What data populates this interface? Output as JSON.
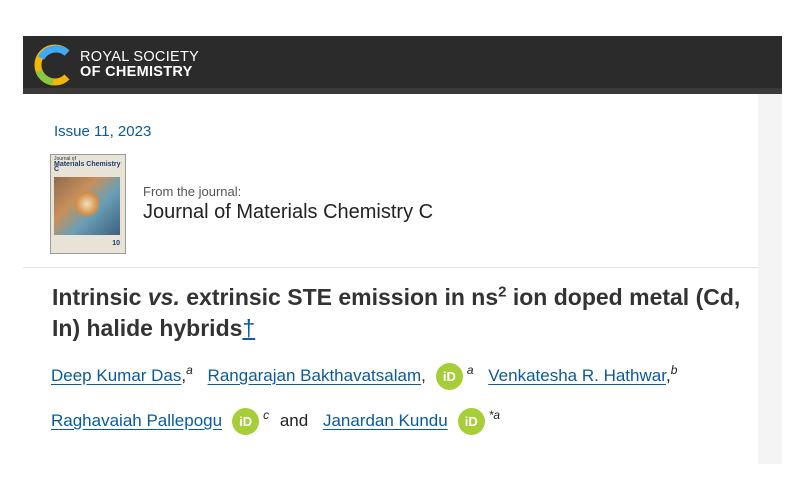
{
  "header": {
    "brand_line1": "ROYAL SOCIETY",
    "brand_line2": "OF CHEMISTRY"
  },
  "issue": {
    "label": "Issue 11, 2023"
  },
  "journal": {
    "from_label": "From the journal:",
    "name": "Journal of Materials Chemistry C",
    "cover_title_small": "Journal of",
    "cover_title_big": "Materials Chemistry C",
    "cover_number": "10"
  },
  "article": {
    "title_part1": "Intrinsic ",
    "title_vs": "vs.",
    "title_part2": " extrinsic STE emission in ns",
    "title_sup": "2",
    "title_part3": " ion doped metal (Cd, In) halide hybrids",
    "title_dagger": "†"
  },
  "authors": [
    {
      "name": "Deep Kumar Das",
      "aff": "a",
      "orcid": false
    },
    {
      "name": "Rangarajan Bakthavatsalam",
      "aff": "a",
      "orcid": true
    },
    {
      "name": "Venkatesha R. Hathwar",
      "aff": "b",
      "orcid": false
    },
    {
      "name": "Raghavaiah Pallepogu",
      "aff": "c",
      "orcid": true
    },
    {
      "name": "Janardan Kundu",
      "aff": "*a",
      "orcid": true
    }
  ],
  "orcid_label": "iD",
  "conjunction": "and",
  "colors": {
    "header_bg": "#2b2b2b",
    "link": "#0a5a9c",
    "orcid": "#a6ce39",
    "title": "#333333"
  }
}
